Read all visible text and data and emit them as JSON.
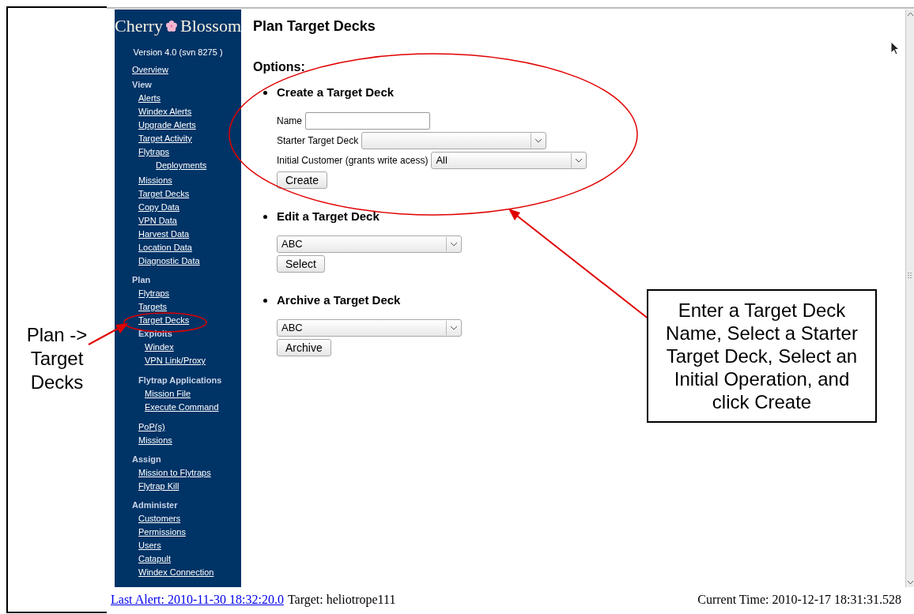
{
  "app": {
    "logo_left": "Cherry",
    "logo_right": "Blossom",
    "version": "Version 4.0 (svn 8275 )"
  },
  "sidebar": {
    "items": [
      {
        "kind": "link",
        "label": "Overview"
      },
      {
        "kind": "heading",
        "label": "View",
        "children": [
          {
            "kind": "link",
            "label": "Alerts"
          },
          {
            "kind": "link",
            "label": "Windex Alerts"
          },
          {
            "kind": "link",
            "label": "Upgrade Alerts"
          },
          {
            "kind": "link",
            "label": "Target Activity"
          },
          {
            "kind": "link",
            "label": "Flytraps",
            "children": [
              {
                "kind": "link",
                "label": "Deployments"
              }
            ]
          },
          {
            "kind": "link",
            "label": "Missions"
          },
          {
            "kind": "link",
            "label": "Target Decks"
          },
          {
            "kind": "link",
            "label": "Copy Data"
          },
          {
            "kind": "link",
            "label": "VPN Data"
          },
          {
            "kind": "link",
            "label": "Harvest Data"
          },
          {
            "kind": "link",
            "label": "Location Data"
          },
          {
            "kind": "link",
            "label": "Diagnostic Data"
          }
        ]
      },
      {
        "kind": "heading",
        "label": "Plan",
        "children": [
          {
            "kind": "link",
            "label": "Flytraps"
          },
          {
            "kind": "link",
            "label": "Targets"
          },
          {
            "kind": "link",
            "label": "Target Decks"
          },
          {
            "kind": "heading",
            "label": "Exploits",
            "children": [
              {
                "kind": "link",
                "label": "Windex"
              },
              {
                "kind": "link",
                "label": "VPN Link/Proxy"
              }
            ]
          },
          {
            "kind": "heading",
            "label": "Flytrap Applications",
            "children": [
              {
                "kind": "link",
                "label": "Mission File"
              },
              {
                "kind": "link",
                "label": "Execute Command"
              }
            ]
          },
          {
            "kind": "link",
            "label": "PoP(s)"
          },
          {
            "kind": "link",
            "label": "Missions"
          }
        ]
      },
      {
        "kind": "heading",
        "label": "Assign",
        "children": [
          {
            "kind": "link",
            "label": "Mission to Flytraps"
          },
          {
            "kind": "link",
            "label": "Flytrap Kill"
          }
        ]
      },
      {
        "kind": "heading",
        "label": "Administer",
        "children": [
          {
            "kind": "link",
            "label": "Customers"
          },
          {
            "kind": "link",
            "label": "Permissions"
          },
          {
            "kind": "link",
            "label": "Users"
          },
          {
            "kind": "link",
            "label": "Catapult"
          },
          {
            "kind": "link",
            "label": "Windex Connection"
          }
        ]
      }
    ]
  },
  "page": {
    "title": "Plan Target Decks",
    "options_heading": "Options:",
    "sections": [
      {
        "heading": "Create a Target Deck",
        "fields": [
          {
            "kind": "text",
            "label": "Name"
          },
          {
            "kind": "select",
            "label": "Starter Target Deck"
          },
          {
            "kind": "select",
            "label": "Initial Customer (grants write acess)",
            "value": "All"
          }
        ],
        "button": "Create"
      },
      {
        "heading": "Edit a Target Deck",
        "fields": [
          {
            "kind": "select",
            "value": "ABC"
          }
        ],
        "button": "Select"
      },
      {
        "heading": "Archive a Target Deck",
        "fields": [
          {
            "kind": "select",
            "value": "ABC"
          }
        ],
        "button": "Archive"
      }
    ]
  },
  "footer": {
    "last_alert": "Last Alert: 2010-11-30 18:32:20.0",
    "target": "Target: heliotrope111",
    "current_time": "Current Time: 2010-12-17 18:31:31.528"
  },
  "annotations": {
    "side_note": "Plan -> Target Decks",
    "callout": "Enter a Target Deck Name, Select a Starter Target Deck, Select an Initial Operation, and click Create"
  }
}
